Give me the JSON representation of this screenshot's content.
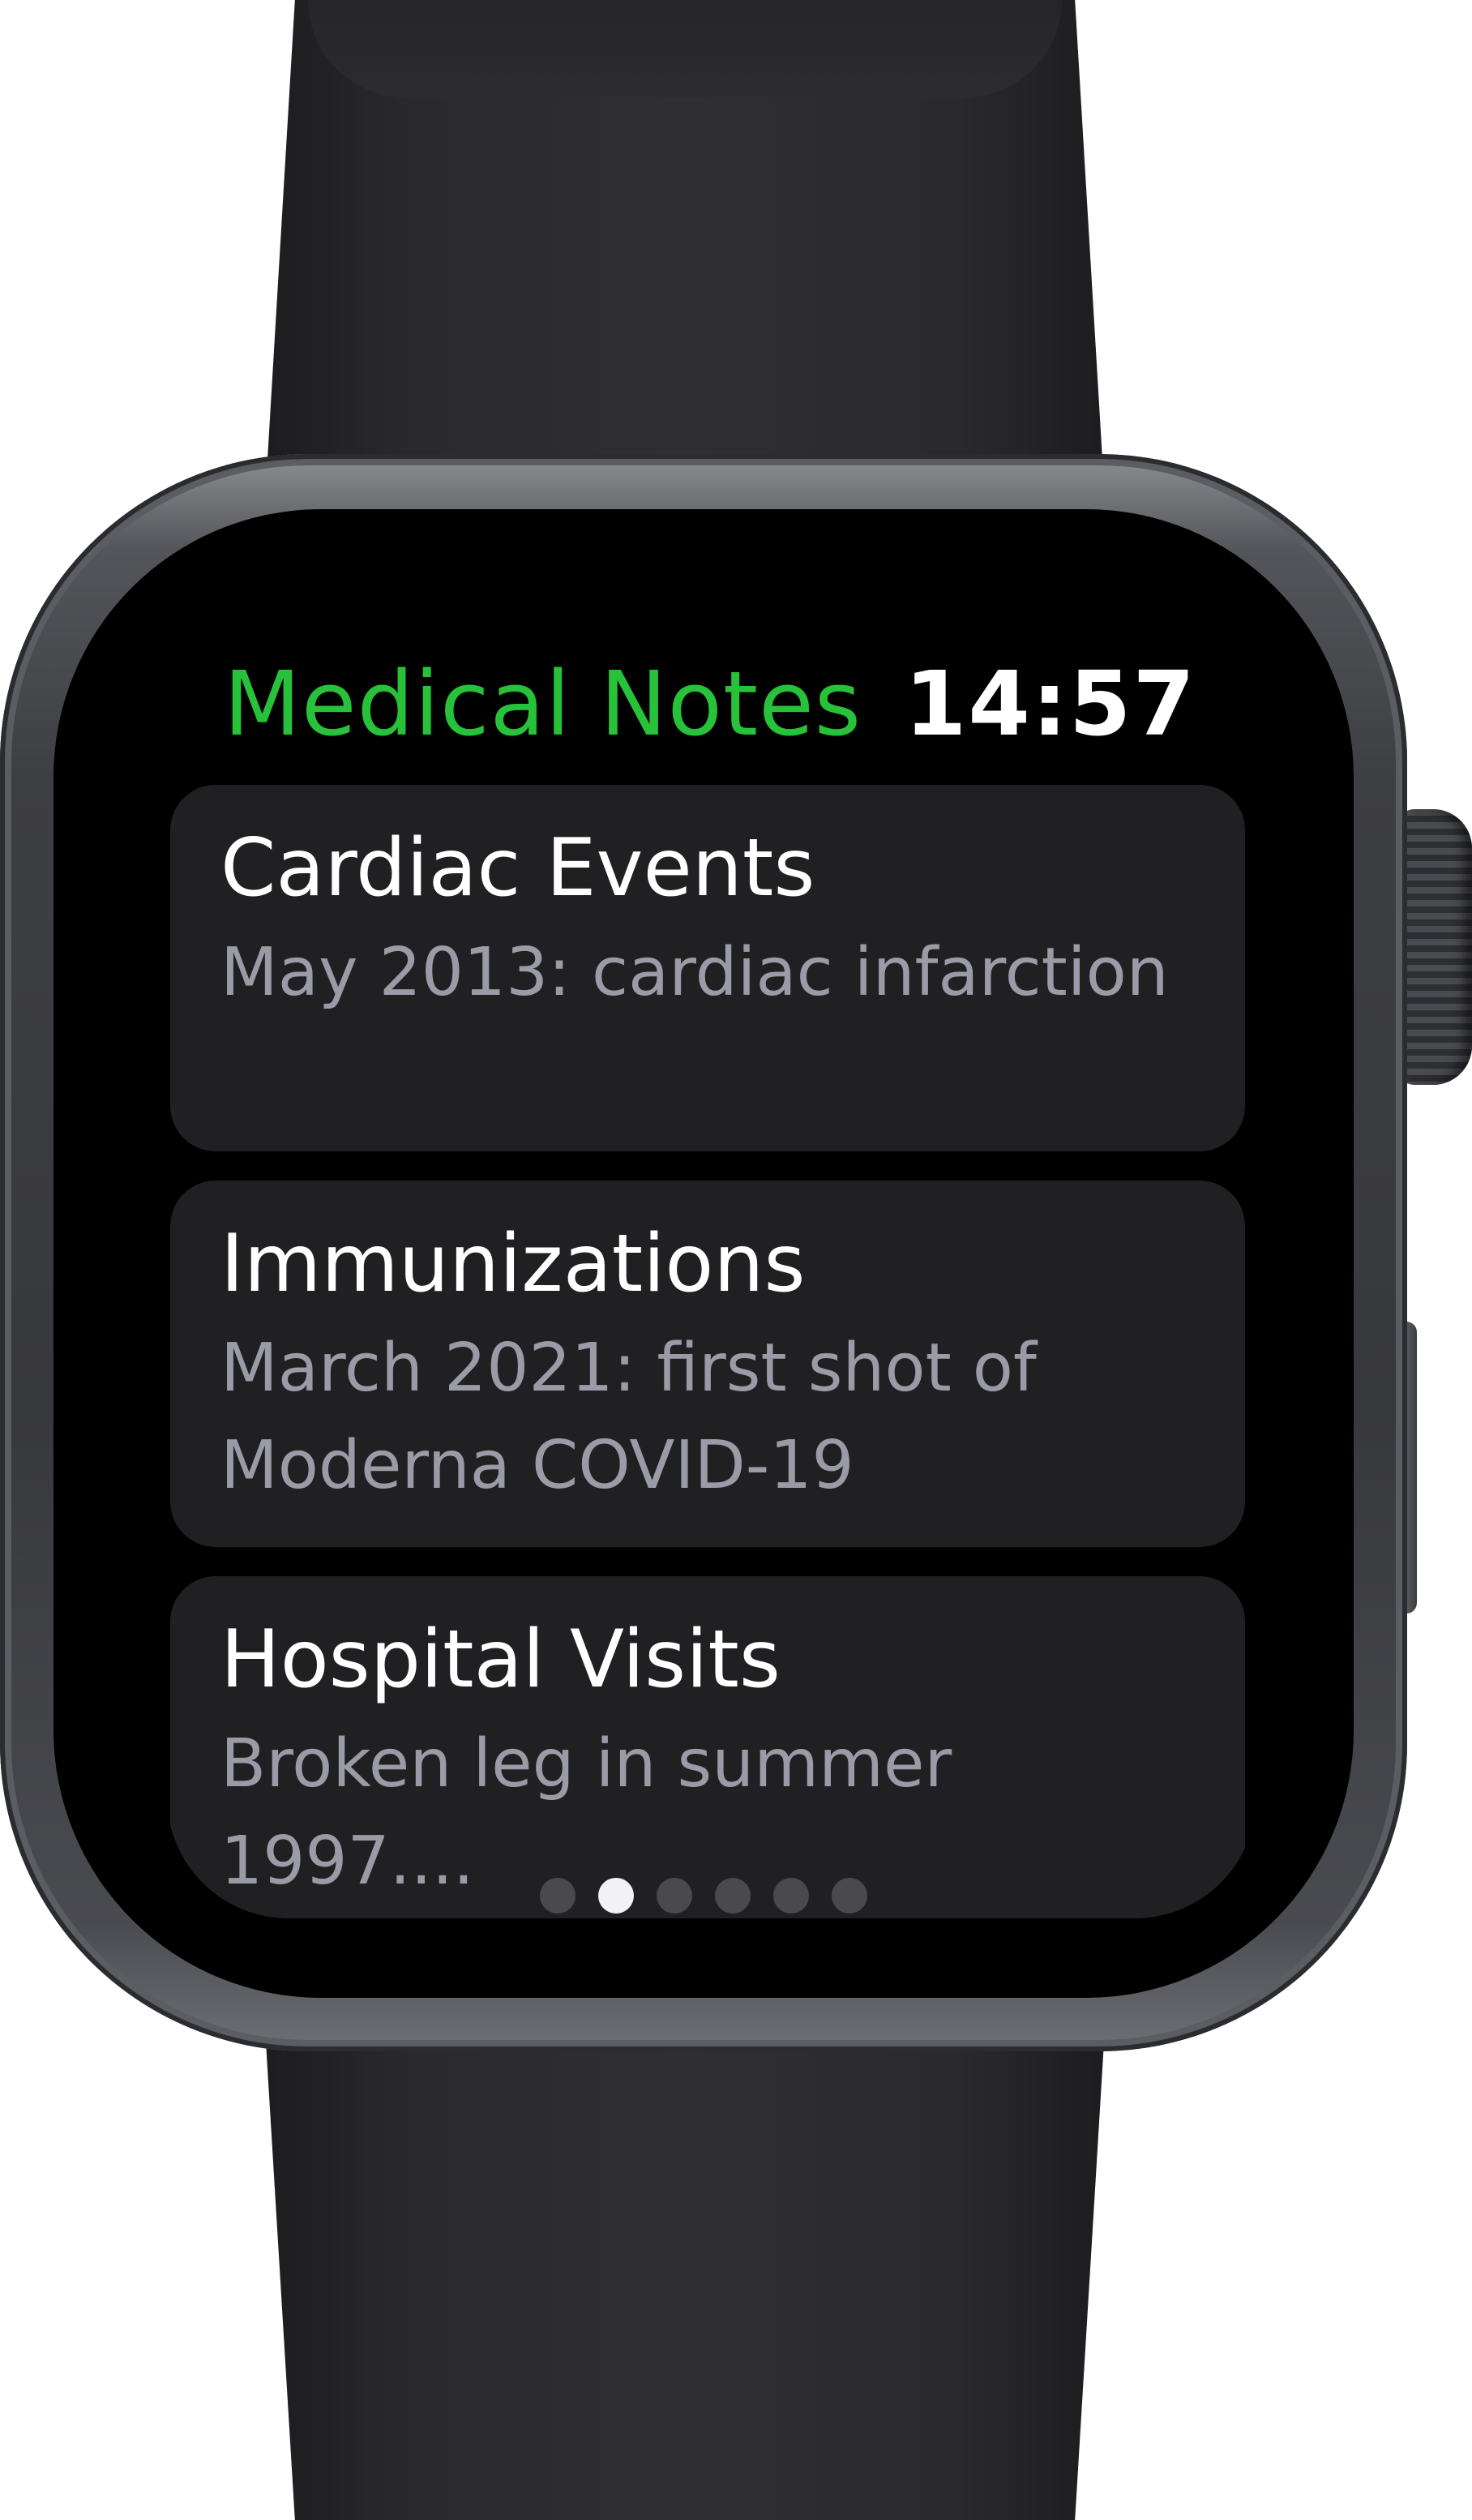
{
  "app": {
    "title": "Medical Notes",
    "time": "14:57",
    "title_color": "#27c13a"
  },
  "notes": [
    {
      "title": "Cardiac Events",
      "detail": "May 2013: cardiac in­farction"
    },
    {
      "title": "Immunizations",
      "detail": "March 2021: first shot of Moderna COVID-19"
    },
    {
      "title": "Hospital Visits",
      "detail": "Broken leg in summer 1997...."
    }
  ],
  "pagination": {
    "page_count": 6,
    "current_page": 2
  },
  "icons": {
    "crown": "digital-crown-icon",
    "side_button": "side-button-icon"
  }
}
